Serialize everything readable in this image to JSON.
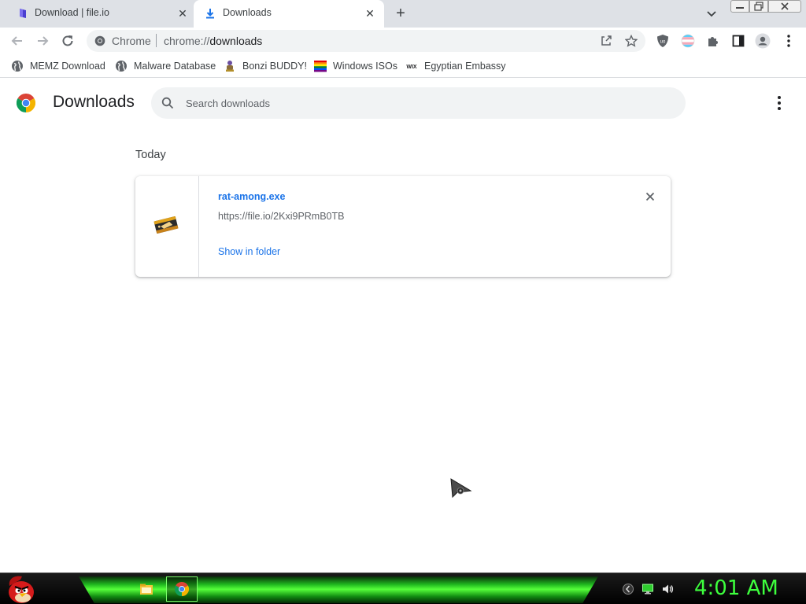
{
  "tabs": [
    {
      "title": "Download | file.io",
      "favicon": "fileio-icon",
      "active": false
    },
    {
      "title": "Downloads",
      "favicon": "download-icon",
      "active": true
    }
  ],
  "omnibox": {
    "site_chip": "Chrome",
    "url_scheme": "chrome://",
    "url_path": "downloads"
  },
  "bookmarks": [
    {
      "label": "MEMZ Download",
      "icon": "globe-icon"
    },
    {
      "label": "Malware Database",
      "icon": "globe-icon"
    },
    {
      "label": "Bonzi BUDDY!",
      "icon": "bonzi-icon"
    },
    {
      "label": "Windows ISOs",
      "icon": "rainbow-flag-icon"
    },
    {
      "label": "Egyptian Embassy",
      "icon": "wix-icon"
    }
  ],
  "page": {
    "title": "Downloads",
    "search_placeholder": "Search downloads",
    "section": "Today"
  },
  "download": {
    "file_name": "rat-among.exe",
    "url": "https://file.io/2Kxi9PRmB0TB",
    "action": "Show in folder"
  },
  "taskbar": {
    "clock": "4:01 AM"
  },
  "colors": {
    "link": "#1a73e8",
    "tab_strip": "#dee1e6",
    "taskbar_green": "#3dff3d"
  }
}
